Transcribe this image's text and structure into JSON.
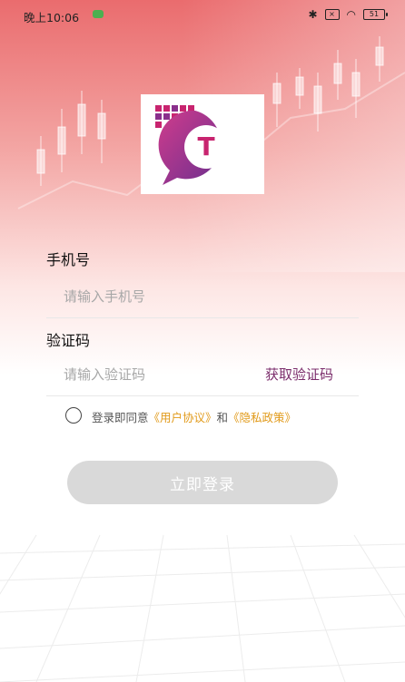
{
  "status_bar": {
    "time": "晚上10:06",
    "sim_label": "×",
    "battery": "51"
  },
  "app": {
    "logo_letter": "T"
  },
  "form": {
    "phone_label": "手机号",
    "phone_placeholder": "请输入手机号",
    "code_label": "验证码",
    "code_placeholder": "请输入验证码",
    "get_code": "获取验证码"
  },
  "agreement": {
    "prefix": "登录即同意",
    "user_agreement": "《用户协议》",
    "and": "和",
    "privacy_policy": "《隐私政策》"
  },
  "login_button": "立即登录",
  "colors": {
    "accent": "#7b2c6b",
    "link": "#e19a1a",
    "button_disabled": "#d9d9d9"
  }
}
